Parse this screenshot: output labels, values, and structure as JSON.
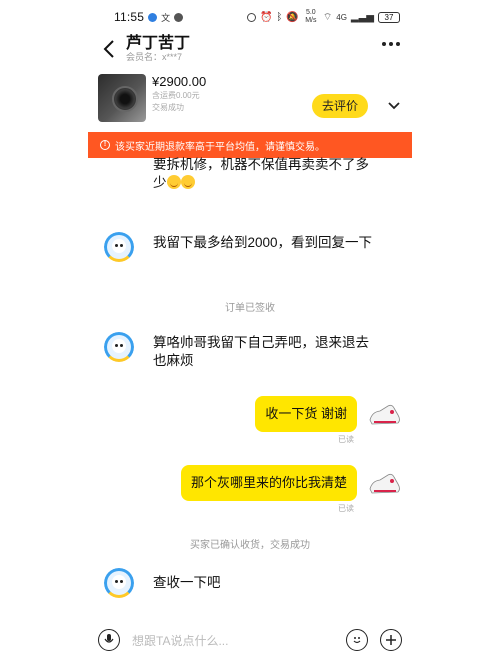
{
  "status_bar": {
    "time": "11:55",
    "network": "5.0 M/s",
    "signal": "4G",
    "battery": "37"
  },
  "header": {
    "title": "芦丁苦丁",
    "subtitle": "会员名：x***7"
  },
  "product": {
    "price": "¥2900.00",
    "shipping": "含运费0.00元",
    "status": "交易成功",
    "rate_button": "去评价"
  },
  "warning": {
    "text": "该买家近期退款率高于平台均值，请谨慎交易。"
  },
  "messages": [
    {
      "side": "left",
      "text": "要拆机修，机器不保值再卖卖不了多少"
    },
    {
      "side": "left",
      "text": "我留下最多给到2000，看到回复一下"
    },
    {
      "side": "system",
      "text": "订单已签收"
    },
    {
      "side": "left",
      "text": "算咯帅哥我留下自己弄吧，退来退去也麻烦"
    },
    {
      "side": "right",
      "text": "收一下货 谢谢",
      "status": "已读"
    },
    {
      "side": "right",
      "text": "那个灰哪里来的你比我清楚",
      "status": "已读"
    },
    {
      "side": "system",
      "text": "买家已确认收货，交易成功"
    },
    {
      "side": "left",
      "text": "查收一下吧"
    }
  ],
  "input": {
    "placeholder": "想跟TA说点什么..."
  },
  "colors": {
    "accent_yellow": "#ffe600",
    "warning_orange": "#ff5722"
  }
}
